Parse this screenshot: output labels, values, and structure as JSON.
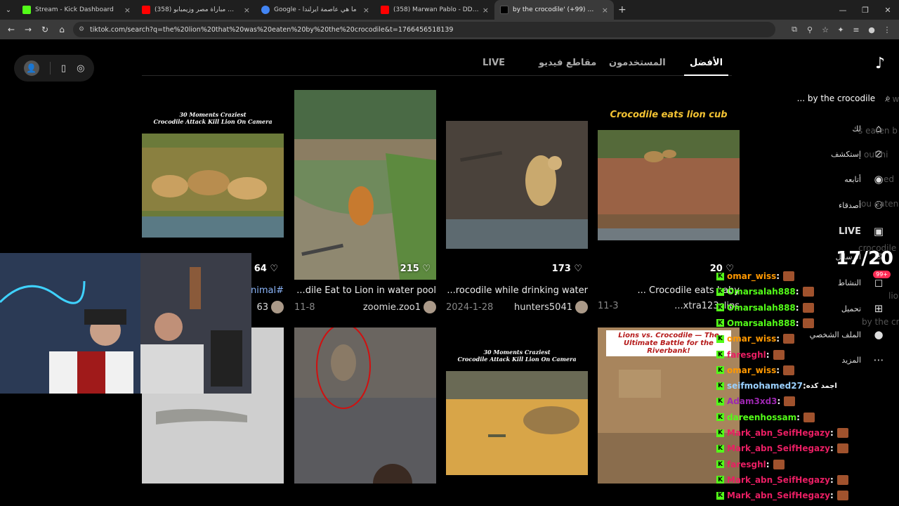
{
  "browser": {
    "tabs": [
      {
        "title": "Stream - Kick Dashboard",
        "color": "#53fc18"
      },
      {
        "title": "ملخص مباراة مصر وزيمبابو (358)",
        "color": "#ff0000"
      },
      {
        "title": "Google - ما هي عاصمة أيرلندا",
        "color": "#4285f4"
      },
      {
        "title": "(358) Marwan Pablo - DDDD | ...",
        "color": "#ff0000"
      },
      {
        "title": "by the crocodile' اعثر على (99+)",
        "color": "#000000"
      }
    ],
    "new_tab": "+",
    "url": "tiktok.com/search?q=the%20lion%20that%20was%20eaten%20by%20the%20crocodile&t=1766456518139"
  },
  "search": {
    "query": "... by the crocodile"
  },
  "tabs": [
    "الأفضل",
    "المستخدمون",
    "مقاطع فيديو",
    "LIVE"
  ],
  "sidebar": {
    "items": [
      {
        "label": "لك",
        "icon": "home-icon"
      },
      {
        "label": "إستكشف",
        "icon": "compass-icon"
      },
      {
        "label": "أتابعه",
        "icon": "following-icon"
      },
      {
        "label": "أصدقاء",
        "icon": "friends-icon"
      },
      {
        "label": "LIVE",
        "icon": "live-icon"
      },
      {
        "label": "الرسائل",
        "icon": "messages-icon"
      },
      {
        "label": "النشاط",
        "icon": "activity-icon",
        "badge": "99+"
      },
      {
        "label": "تحميل",
        "icon": "upload-icon"
      },
      {
        "label": "الملف الشخصي",
        "icon": "profile-icon"
      },
      {
        "label": "المزيد",
        "icon": "more-icon"
      }
    ]
  },
  "counter": "17/20",
  "videos": [
    {
      "likes": "64",
      "caption": "nimal#",
      "date": "",
      "user": "63",
      "overlay": "30 Moments Craziest\nCrocodile Attack Kill Lion On Camera"
    },
    {
      "likes": "215",
      "caption": "...dile Eat to Lion in water pool",
      "date": "11-8",
      "user": "zoomie.zoo1",
      "overlay": ""
    },
    {
      "likes": "173",
      "caption": "...rocodile while drinking water",
      "date": "2024-1-28",
      "user": "hunters5041",
      "overlay": ""
    },
    {
      "likes": "20",
      "caption": "... Crocodile eats baby",
      "date": "11-3",
      "user": "...xtra123clips",
      "overlay": "Crocodile eats lion cub"
    },
    {
      "likes": "",
      "caption": "",
      "date": "",
      "user": "",
      "overlay": ""
    },
    {
      "likes": "",
      "caption": "",
      "date": "",
      "user": "",
      "overlay": ""
    },
    {
      "likes": "",
      "caption": "",
      "date": "",
      "user": "",
      "overlay": "30 Moments Craziest\nCrocodile Attack Kill Lion On Camera"
    },
    {
      "likes": "",
      "caption": "",
      "date": "",
      "user": "",
      "overlay": "Lions vs. Crocodile — The Ultimate Battle for the Riverbank!"
    }
  ],
  "chat": [
    {
      "user": "omar_wiss",
      "text": "",
      "color": "#ff9800"
    },
    {
      "user": "Omarsalah888",
      "text": "",
      "color": "#53fc18"
    },
    {
      "user": "Omarsalah888",
      "text": "",
      "color": "#53fc18"
    },
    {
      "user": "Omarsalah888",
      "text": "",
      "color": "#53fc18"
    },
    {
      "user": "omar_wiss",
      "text": "",
      "color": "#ff9800"
    },
    {
      "user": "faresghl",
      "text": "",
      "color": "#e91e63"
    },
    {
      "user": "omar_wiss",
      "text": "",
      "color": "#ff9800"
    },
    {
      "user": "seifmohamed27",
      "text": "اجمد كده",
      "color": "#9ad0ff"
    },
    {
      "user": "Adam3xd3",
      "text": "",
      "color": "#9c27b0"
    },
    {
      "user": "dareenhossam",
      "text": "",
      "color": "#53fc18"
    },
    {
      "user": "Mark_abn_SeifHegazy",
      "text": "",
      "color": "#e91e63"
    },
    {
      "user": "Mark_abn_SeifHegazy",
      "text": "",
      "color": "#e91e63"
    },
    {
      "user": "faresghl",
      "text": "",
      "color": "#e91e63"
    },
    {
      "user": "Mark_abn_SeifHegazy",
      "text": "",
      "color": "#e91e63"
    },
    {
      "user": "Mark_abn_SeifHegazy",
      "text": "",
      "color": "#e91e63"
    }
  ],
  "ghost_text": [
    "t w",
    "s eaten b",
    "out hi",
    "ed",
    "ou eaten",
    "crocodile",
    "lio",
    "by the cr"
  ]
}
